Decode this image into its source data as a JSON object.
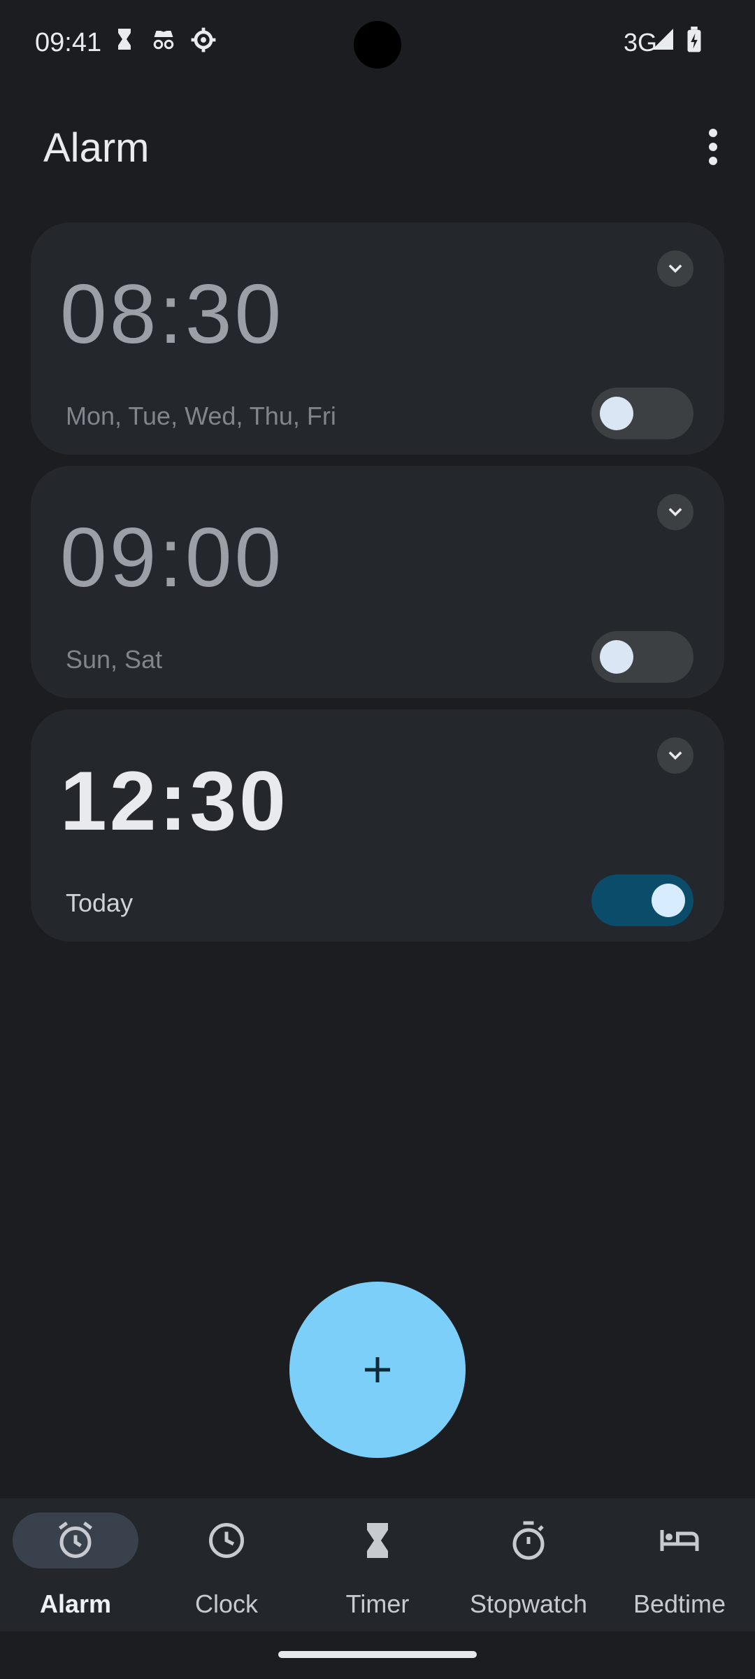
{
  "status_bar": {
    "time": "09:41",
    "network": "3G",
    "icons": [
      "hourglass-icon",
      "incognito-icon",
      "settings-gear-icon",
      "signal-icon",
      "battery-charging-icon"
    ]
  },
  "app_bar": {
    "title": "Alarm",
    "more_icon": "more-vert-icon"
  },
  "alarms": [
    {
      "time": "08:30",
      "days": "Mon, Tue, Wed, Thu, Fri",
      "enabled": false
    },
    {
      "time": "09:00",
      "days": "Sun, Sat",
      "enabled": false
    },
    {
      "time": "12:30",
      "days": "Today",
      "enabled": true
    }
  ],
  "fab": {
    "icon": "add-icon"
  },
  "bottom_nav": {
    "items": [
      {
        "label": "Alarm",
        "icon": "alarm-clock-icon",
        "selected": true
      },
      {
        "label": "Clock",
        "icon": "clock-icon",
        "selected": false
      },
      {
        "label": "Timer",
        "icon": "hourglass-icon",
        "selected": false
      },
      {
        "label": "Stopwatch",
        "icon": "stopwatch-icon",
        "selected": false
      },
      {
        "label": "Bedtime",
        "icon": "bed-icon",
        "selected": false
      }
    ]
  },
  "colors": {
    "background": "#1b1d20",
    "card": "#24272b",
    "fab": "#7ccff9",
    "toggle_on": "#0b4c6a"
  }
}
